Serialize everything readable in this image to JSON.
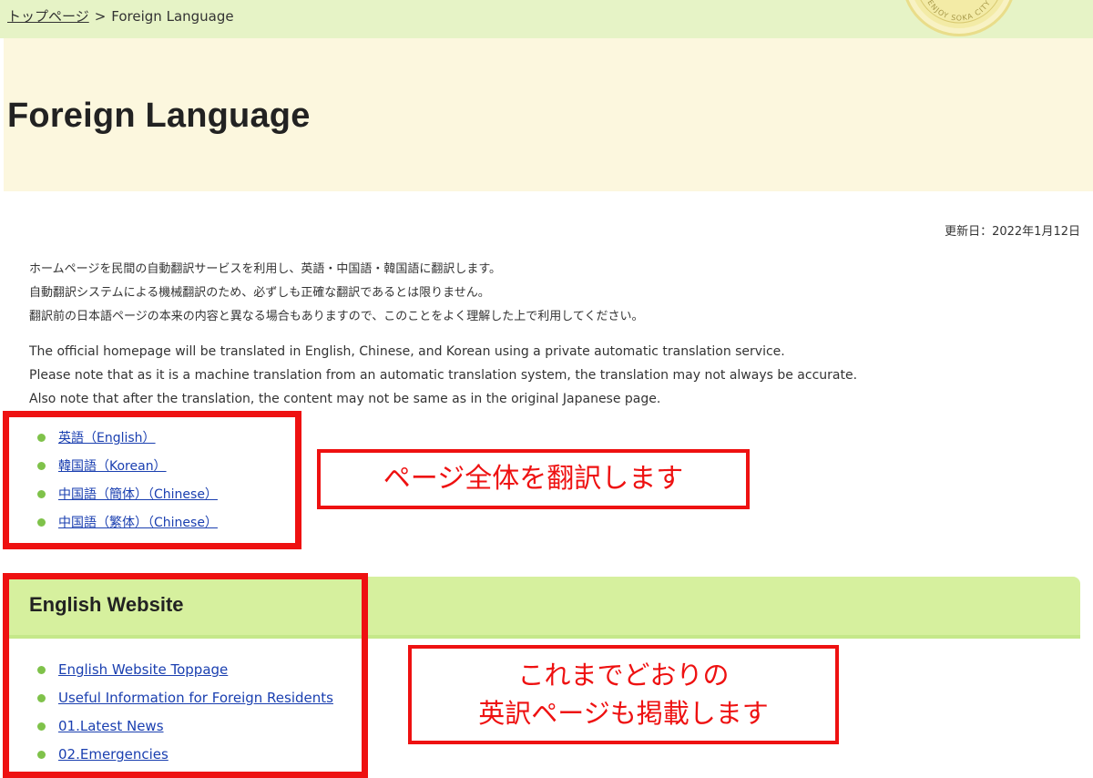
{
  "breadcrumb": {
    "home": "トップページ",
    "separator": ">",
    "current": "Foreign Language"
  },
  "seal": {
    "text": "ENJOY SOKA CITY"
  },
  "page": {
    "title": "Foreign Language",
    "updated": "更新日：2022年1月12日"
  },
  "notice_ja": [
    "ホームページを民間の自動翻訳サービスを利用し、英語・中国語・韓国語に翻訳します。",
    "自動翻訳システムによる機械翻訳のため、必ずしも正確な翻訳であるとは限りません。",
    "翻訳前の日本語ページの本来の内容と異なる場合もありますので、このことをよく理解した上で利用してください。"
  ],
  "notice_en": [
    "The official homepage will be translated in English, Chinese, and Korean using a private automatic translation service.",
    "Please note that as it is a machine translation from an automatic translation system, the translation may not always be accurate.",
    "Also note that after the translation, the content may not be same as in the original Japanese page."
  ],
  "translate_links": [
    "英語（English）",
    "韓国語（Korean）",
    "中国語（簡体）（Chinese）",
    "中国語（繁体）（Chinese）"
  ],
  "english_section": {
    "heading": "English Website",
    "links": [
      "English Website Toppage",
      "Useful Information for Foreign Residents",
      "01.Latest News",
      "02.Emergencies"
    ]
  },
  "annotations": {
    "callout1": "ページ全体を翻訳します",
    "callout2_line1": "これまでどおりの",
    "callout2_line2": "英訳ページも掲載します"
  },
  "colors": {
    "crumb_bar": "#e6f3c6",
    "title_banner": "#fcf7de",
    "section_bar": "#d6f09e",
    "link": "#1a3fb0",
    "bullet": "#7fc24a",
    "annotation_red": "#ee1111"
  }
}
